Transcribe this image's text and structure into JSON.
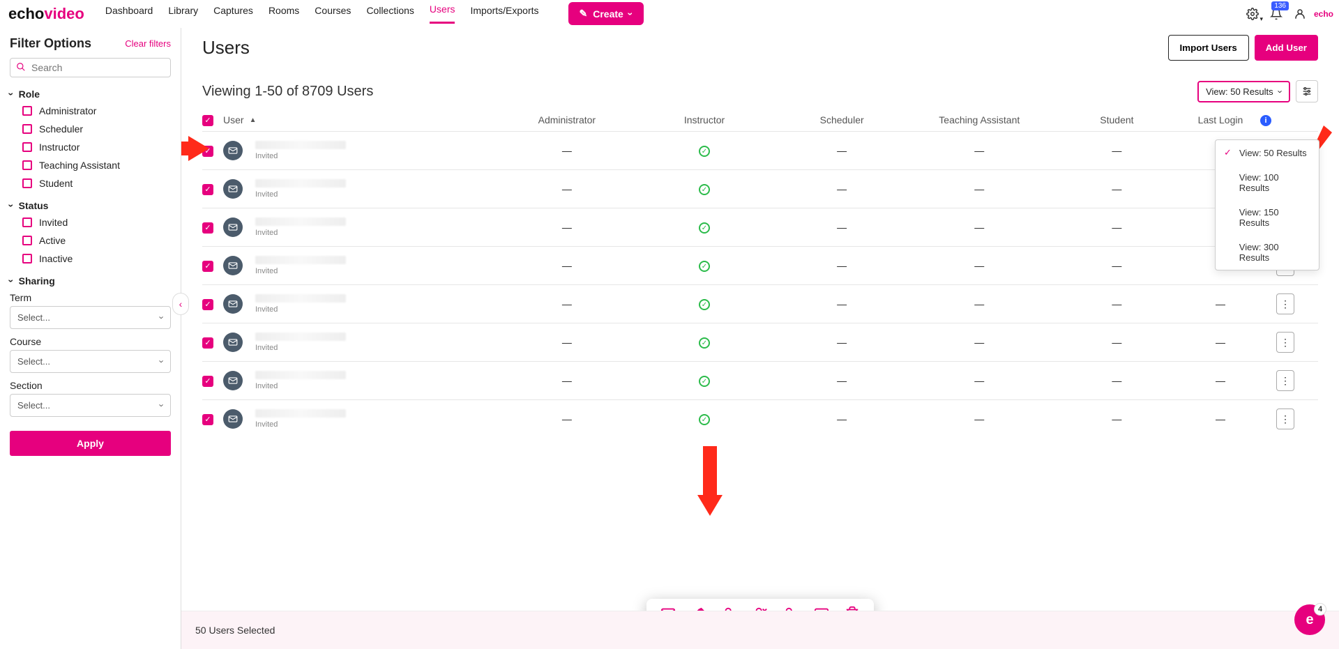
{
  "brand": {
    "part1": "echo",
    "part2": "video"
  },
  "nav": {
    "items": [
      {
        "label": "Dashboard"
      },
      {
        "label": "Library"
      },
      {
        "label": "Captures"
      },
      {
        "label": "Rooms"
      },
      {
        "label": "Courses"
      },
      {
        "label": "Collections"
      },
      {
        "label": "Users",
        "active": true
      },
      {
        "label": "Imports/Exports"
      }
    ],
    "create_label": "Create"
  },
  "topright": {
    "notification_badge": "136",
    "minilogo": "echo"
  },
  "sidebar": {
    "title": "Filter Options",
    "clear": "Clear filters",
    "search_placeholder": "Search",
    "groups": {
      "role": {
        "label": "Role",
        "items": [
          "Administrator",
          "Scheduler",
          "Instructor",
          "Teaching Assistant",
          "Student"
        ]
      },
      "status": {
        "label": "Status",
        "items": [
          "Invited",
          "Active",
          "Inactive"
        ]
      },
      "sharing": {
        "label": "Sharing",
        "fields": [
          {
            "label": "Term",
            "placeholder": "Select..."
          },
          {
            "label": "Course",
            "placeholder": "Select..."
          },
          {
            "label": "Section",
            "placeholder": "Select..."
          }
        ]
      }
    },
    "apply": "Apply"
  },
  "page": {
    "title": "Users",
    "import_btn": "Import Users",
    "add_btn": "Add User",
    "viewing_text": "Viewing 1-50 of 8709 Users",
    "view_dropdown_label": "View: 50 Results",
    "view_options": [
      "View: 50 Results",
      "View: 100 Results",
      "View: 150 Results",
      "View: 300 Results"
    ],
    "table_headers": {
      "user": "User",
      "admin": "Administrator",
      "instructor": "Instructor",
      "scheduler": "Scheduler",
      "ta": "Teaching Assistant",
      "student": "Student",
      "lastlogin": "Last Login"
    },
    "row_count": 8,
    "invited_label": "Invited",
    "dash": "—",
    "footer_selected": "50 Users Selected",
    "fab_count": "4",
    "fab_letter": "e"
  }
}
